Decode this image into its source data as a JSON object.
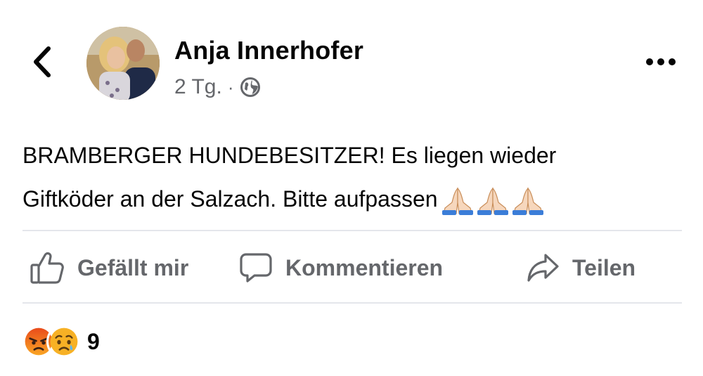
{
  "post": {
    "author": "Anja Innerhofer",
    "time": "2 Tg.",
    "separator": "·",
    "audience_icon": "globe-icon",
    "text_line1": "BRAMBERGER HUNDEBESITZER! Es liegen wieder",
    "text_line2": "Giftköder an der Salzach. Bitte aufpassen",
    "text_emojis": [
      "folded-hands",
      "folded-hands",
      "folded-hands"
    ]
  },
  "actions": {
    "like_label": "Gefällt mir",
    "comment_label": "Kommentieren",
    "share_label": "Teilen"
  },
  "reactions": {
    "icons": [
      "angry-icon",
      "sad-icon"
    ],
    "count": "9"
  },
  "colors": {
    "text": "#050505",
    "secondary": "#65676b",
    "divider": "#e4e6eb",
    "angry": "#e9710f",
    "sad": "#f7b125"
  }
}
